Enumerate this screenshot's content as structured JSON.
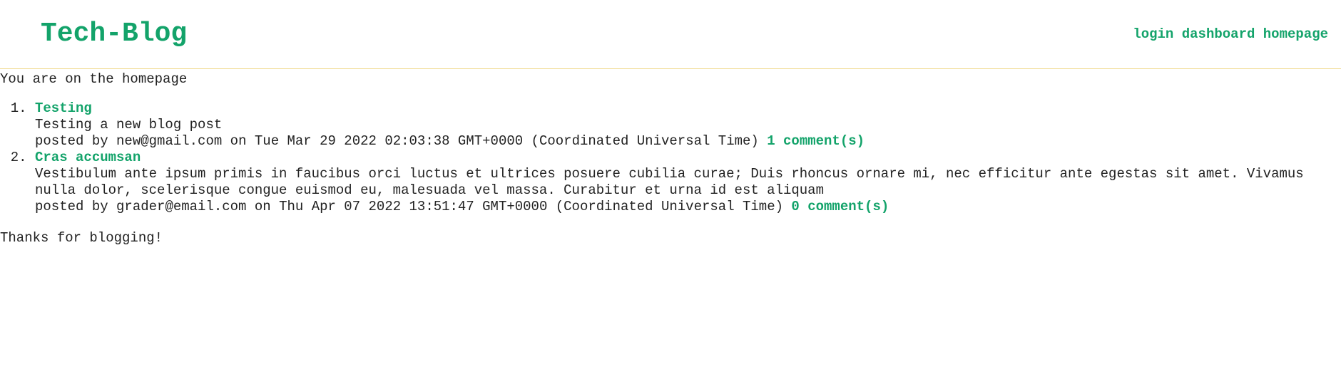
{
  "header": {
    "site_title": "Tech-Blog",
    "nav": {
      "login": "login",
      "dashboard": "dashboard",
      "homepage": "homepage"
    }
  },
  "main": {
    "status_text": "You are on the homepage",
    "posts": [
      {
        "number": "1",
        "title": "Testing",
        "body": "Testing a new blog post",
        "posted_by_prefix": "posted by",
        "author": "new@gmail.com",
        "on_word": "on",
        "date": "Tue Mar 29 2022 02:03:38 GMT+0000 (Coordinated Universal Time)",
        "comments_label": "1 comment(s)"
      },
      {
        "number": "2",
        "title": "Cras accumsan",
        "body": "Vestibulum ante ipsum primis in faucibus orci luctus et ultrices posuere cubilia curae; Duis rhoncus ornare mi, nec efficitur ante egestas sit amet. Vivamus nulla dolor, scelerisque congue euismod eu, malesuada vel massa. Curabitur et urna id est aliquam",
        "posted_by_prefix": "posted by",
        "author": "grader@email.com",
        "on_word": "on",
        "date": "Thu Apr 07 2022 13:51:47 GMT+0000 (Coordinated Universal Time)",
        "comments_label": "0 comment(s)"
      }
    ],
    "footer_text": "Thanks for blogging!"
  },
  "colors": {
    "accent": "#13a36a",
    "divider": "#f0d98a",
    "text": "#222222"
  }
}
